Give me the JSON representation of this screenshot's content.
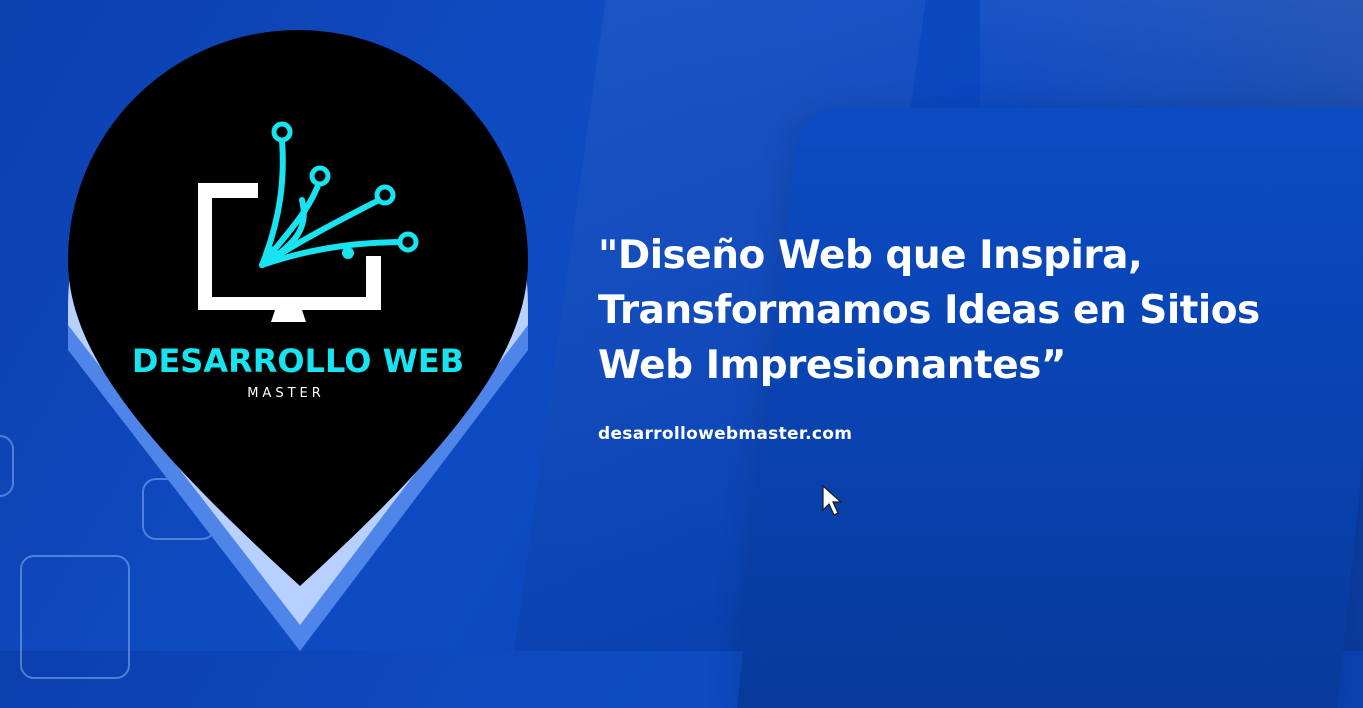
{
  "logo": {
    "brand_line1": "DESARROLLO WEB",
    "brand_line2": "MASTER",
    "icon": "monitor-circuit-icon"
  },
  "hero": {
    "headline_lines": [
      "\"Diseño Web que Inspira,",
      "Transformamos Ideas en Sitios",
      "Web Impresionantes”"
    ],
    "website": "desarrollowebmaster.com"
  },
  "colors": {
    "background": "#0b45b8",
    "pin_black": "#000000",
    "pin_light": "#b7d0ff",
    "pin_mid": "#6f9bf0",
    "accent_cyan": "#18e3f0",
    "text": "#ffffff"
  }
}
